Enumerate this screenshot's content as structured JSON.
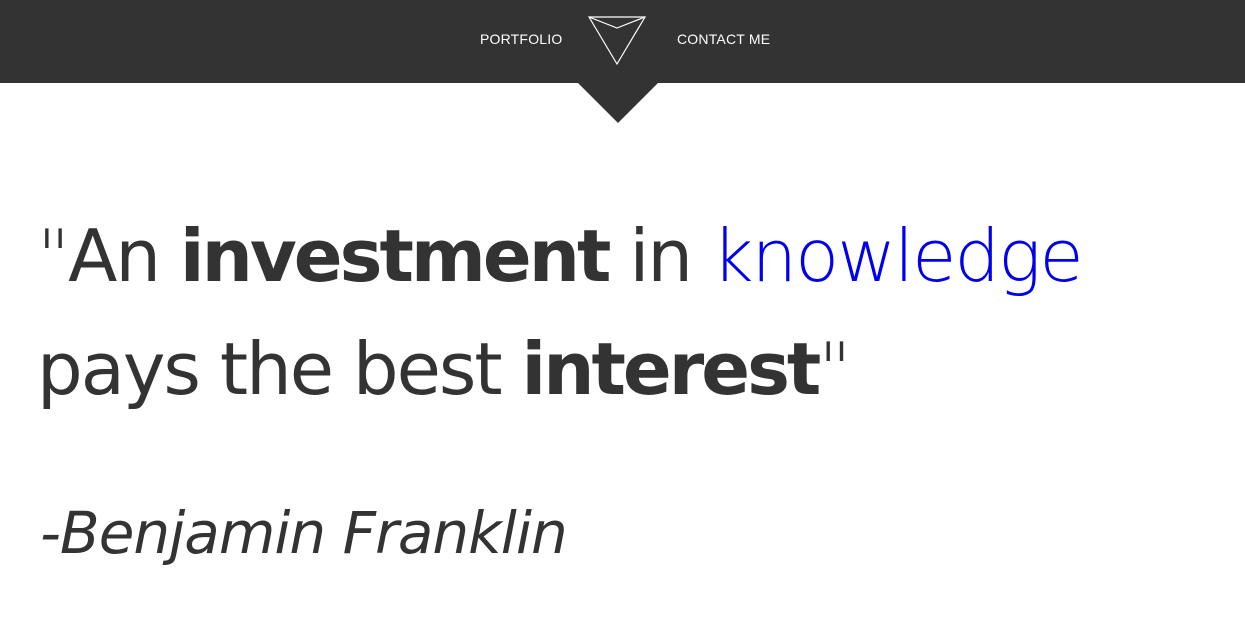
{
  "nav": {
    "portfolio_label": "PORTFOLIO",
    "contact_label": "CONTACT ME",
    "logo_icon": "triangle-logo-icon",
    "background_color": "#333333"
  },
  "quote": {
    "open_quote": "\"",
    "word_an": "An",
    "word_investment": "investment",
    "word_in": "in",
    "word_knowledge": "knowledge",
    "word_pays": "pays",
    "word_the": "the",
    "word_best": "best",
    "word_interest": "interest",
    "close_quote": "\"",
    "accent_color": "#0000ee",
    "text_color": "#333333"
  },
  "author": {
    "text": "-Benjamin Franklin"
  }
}
